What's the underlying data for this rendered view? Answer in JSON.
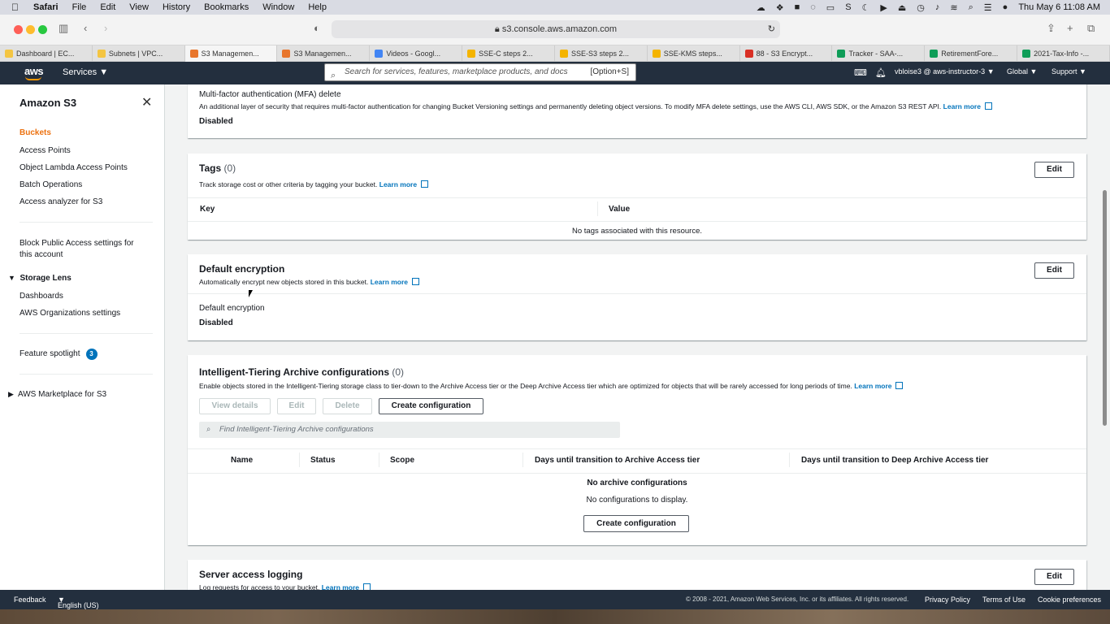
{
  "mac_menu": {
    "app": "Safari",
    "items": [
      "File",
      "Edit",
      "View",
      "History",
      "Bookmarks",
      "Window",
      "Help"
    ],
    "datetime": "Thu May 6  11:08 AM"
  },
  "safari": {
    "url": "s3.console.aws.amazon.com",
    "tabs": [
      {
        "label": "Dashboard | EC...",
        "color": "#f4c542"
      },
      {
        "label": "Subnets | VPC...",
        "color": "#f4c542"
      },
      {
        "label": "S3 Managemen...",
        "color": "#e8762d"
      },
      {
        "label": "S3 Managemen...",
        "color": "#e8762d"
      },
      {
        "label": "Videos - Googl...",
        "color": "#4285f4"
      },
      {
        "label": "SSE-C steps 2...",
        "color": "#f4b400"
      },
      {
        "label": "SSE-S3 steps 2...",
        "color": "#f4b400"
      },
      {
        "label": "SSE-KMS steps...",
        "color": "#f4b400"
      },
      {
        "label": "88 - S3 Encrypt...",
        "color": "#d93025"
      },
      {
        "label": "Tracker - SAA-...",
        "color": "#0f9d58"
      },
      {
        "label": "RetirementFore...",
        "color": "#0f9d58"
      },
      {
        "label": "2021-Tax-Info -...",
        "color": "#0f9d58"
      }
    ]
  },
  "aws_nav": {
    "logo": "aws",
    "services": "Services",
    "search_placeholder": "Search for services, features, marketplace products, and docs",
    "search_shortcut": "[Option+S]",
    "user": "vbloise3 @ aws-instructor-3",
    "region": "Global",
    "support": "Support"
  },
  "sidebar": {
    "title": "Amazon S3",
    "items": [
      "Buckets",
      "Access Points",
      "Object Lambda Access Points",
      "Batch Operations",
      "Access analyzer for S3"
    ],
    "block_public": "Block Public Access settings for this account",
    "storage_lens": "Storage Lens",
    "storage_lens_items": [
      "Dashboards",
      "AWS Organizations settings"
    ],
    "feature_spotlight": "Feature spotlight",
    "feature_count": "3",
    "marketplace": "AWS Marketplace for S3"
  },
  "mfa": {
    "label": "Multi-factor authentication (MFA) delete",
    "desc": "An additional layer of security that requires multi-factor authentication for changing Bucket Versioning settings and permanently deleting object versions. To modify MFA delete settings, use the AWS CLI, AWS SDK, or the Amazon S3 REST API.",
    "learn_more": "Learn more",
    "value": "Disabled"
  },
  "tags": {
    "title": "Tags",
    "count": "(0)",
    "desc": "Track storage cost or other criteria by tagging your bucket.",
    "learn_more": "Learn more",
    "edit": "Edit",
    "col_key": "Key",
    "col_value": "Value",
    "empty": "No tags associated with this resource."
  },
  "encryption": {
    "title": "Default encryption",
    "desc": "Automatically encrypt new objects stored in this bucket.",
    "learn_more": "Learn more",
    "edit": "Edit",
    "label": "Default encryption",
    "value": "Disabled"
  },
  "tiering": {
    "title": "Intelligent-Tiering Archive configurations",
    "count": "(0)",
    "desc": "Enable objects stored in the Intelligent-Tiering storage class to tier-down to the Archive Access tier or the Deep Archive Access tier which are optimized for objects that will be rarely accessed for long periods of time.",
    "learn_more": "Learn more",
    "btn_view": "View details",
    "btn_edit": "Edit",
    "btn_delete": "Delete",
    "btn_create": "Create configuration",
    "filter_placeholder": "Find Intelligent-Tiering Archive configurations",
    "columns": [
      "Name",
      "Status",
      "Scope",
      "Days until transition to Archive Access tier",
      "Days until transition to Deep Archive Access tier"
    ],
    "empty_title": "No archive configurations",
    "empty_desc": "No configurations to display.",
    "empty_create": "Create configuration"
  },
  "logging": {
    "title": "Server access logging",
    "desc": "Log requests for access to your bucket.",
    "learn_more": "Learn more",
    "edit": "Edit"
  },
  "footer": {
    "feedback": "Feedback",
    "language": "English (US)",
    "copyright": "© 2008 - 2021, Amazon Web Services, Inc. or its affiliates. All rights reserved.",
    "privacy": "Privacy Policy",
    "terms": "Terms of Use",
    "cookies": "Cookie preferences"
  }
}
